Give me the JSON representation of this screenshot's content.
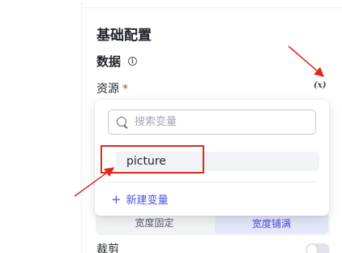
{
  "panel": {
    "section_title": "基础配置",
    "data_title": "数据",
    "info_icon": "info-icon",
    "resource_label": "资源",
    "required_mark": "*",
    "var_toggle": "(x)"
  },
  "width_control": {
    "options": [
      "宽度固定",
      "宽度铺满"
    ],
    "selected": "宽度铺满"
  },
  "crop": {
    "label": "裁剪",
    "enabled": false
  },
  "dropdown": {
    "search_placeholder": "搜索变量",
    "search_value": "",
    "options": [
      "picture"
    ],
    "new_variable_label": "新建变量",
    "plus_icon": "+"
  },
  "annotation": {
    "color": "#e0281e"
  },
  "colors": {
    "accent": "#4d53e8",
    "required": "#e0352b"
  }
}
